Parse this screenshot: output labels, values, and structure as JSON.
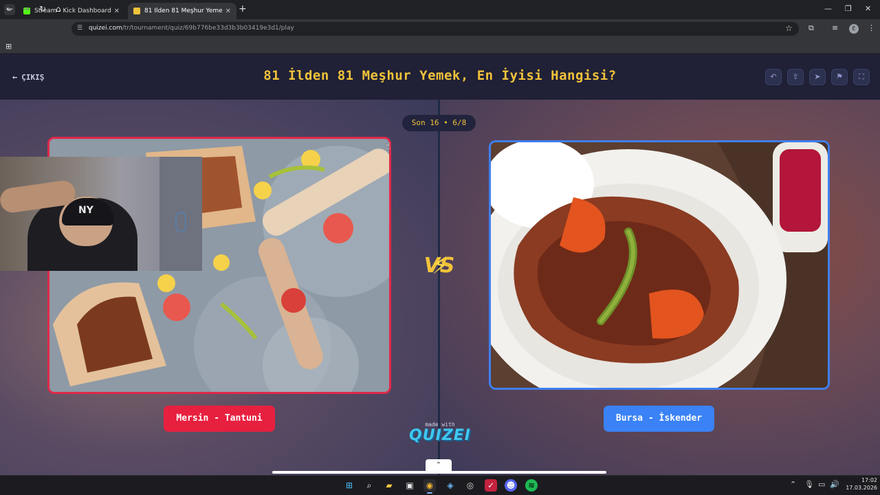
{
  "browser": {
    "tabs": [
      {
        "title": "Stream - Kick Dashboard",
        "favicon_color": "#53fc18",
        "active": false
      },
      {
        "title": "81 İlden 81 Meşhur Yemek, En İ",
        "favicon_color": "#f1c33a",
        "active": true
      }
    ],
    "url_domain": "quizei.com",
    "url_path": "/tr/tournament/quiz/69b776be33d3b3b03419e3d1/play",
    "profile_initial": "E",
    "icons": {
      "tab_search": "chevron-down-icon",
      "new_tab": "plus-icon",
      "back": "arrow-left-icon",
      "forward": "arrow-right-icon",
      "reload": "reload-icon",
      "home": "home-icon",
      "bookmark": "star-icon",
      "extensions": "puzzle-icon",
      "apps": "grid-icon"
    }
  },
  "header": {
    "exit_label": "ÇIKIŞ",
    "title": "81 İlden 81 Meşhur Yemek, En İyisi Hangisi?",
    "buttons": [
      "undo-icon",
      "share-icon",
      "send-icon",
      "flag-icon",
      "fullscreen-icon"
    ]
  },
  "round": {
    "label": "Son 16 • 6/8"
  },
  "versus": {
    "label": "VS"
  },
  "choices": {
    "left": {
      "label": "Mersin - Tantuni",
      "color": "#e8203f",
      "image": "tantuni-photo"
    },
    "right": {
      "label": "Bursa - İskender",
      "color": "#3a82f5",
      "image": "iskender-photo"
    }
  },
  "footer": {
    "made_with": "made with",
    "brand": "QUIZEI"
  },
  "webcam": {
    "cap_logo": "NY"
  },
  "taskbar": {
    "apps": [
      "windows-start-icon",
      "search-icon",
      "file-explorer-icon",
      "store-icon",
      "chrome-icon",
      "app-icon",
      "obs-icon",
      "app-icon-red",
      "discord-icon",
      "spotify-icon"
    ],
    "time": "17:02",
    "date": "17.03.2026"
  },
  "colors": {
    "accent_yellow": "#f1c33a",
    "header_bg": "#202036",
    "left_red": "#e0294a",
    "right_blue": "#3f7ff0"
  }
}
